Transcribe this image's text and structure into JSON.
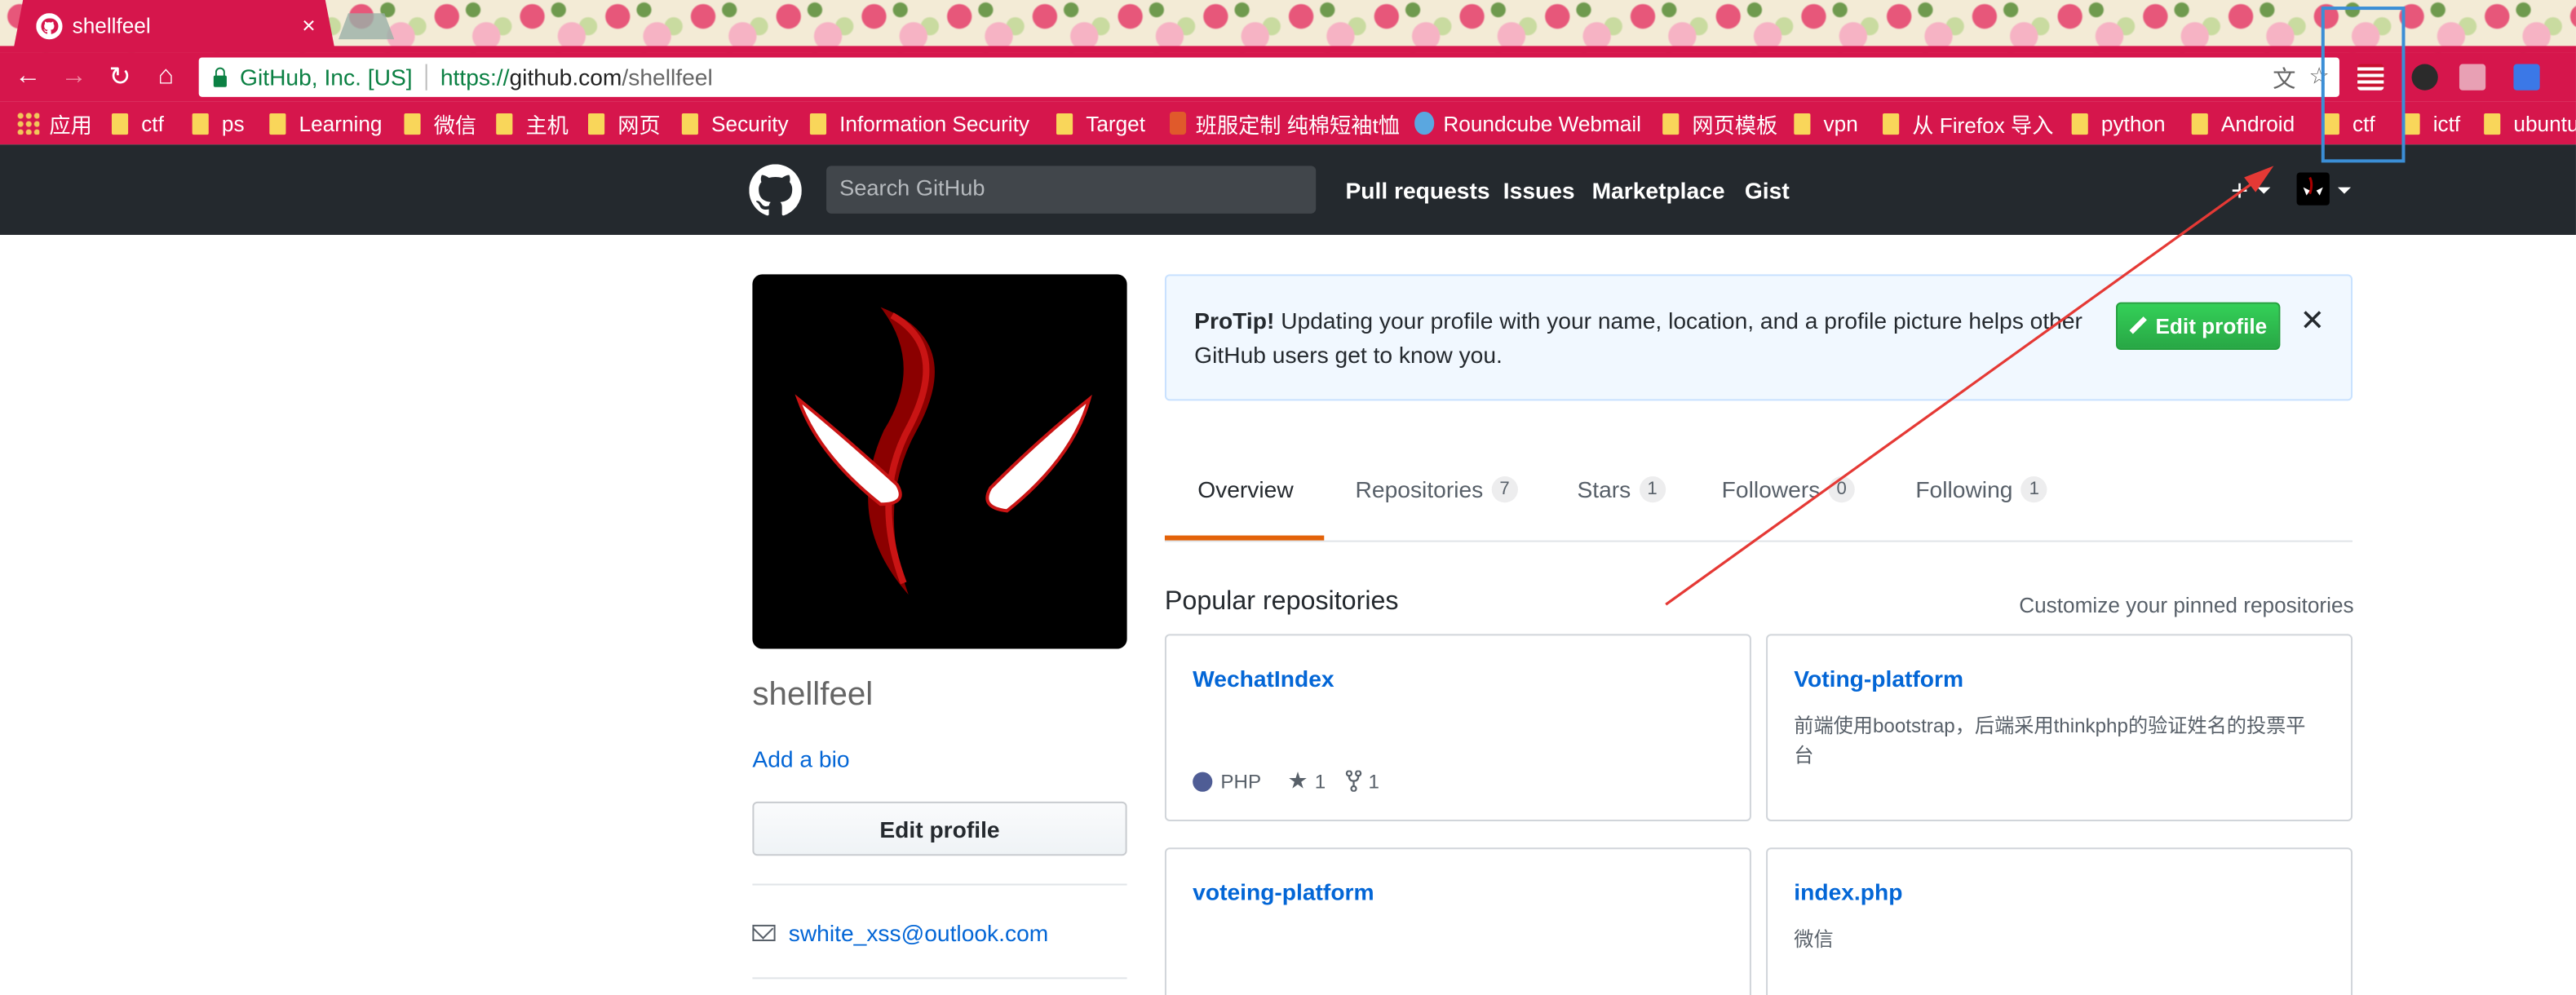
{
  "browser": {
    "tab_title": "shellfeel",
    "tab_close": "×",
    "org_label": "GitHub, Inc. [US]",
    "url_scheme": "https://",
    "url_host": "github.com",
    "url_path": "/shellfeel",
    "bookmarks": [
      "应用",
      "ctf",
      "ps",
      "Learning",
      "微信",
      "主机",
      "网页",
      "Security",
      "Information Security",
      "Target",
      "班服定制 纯棉短袖t恤",
      "Roundcube Webmail",
      "网页模板",
      "vpn",
      "从 Firefox 导入",
      "python",
      "Android",
      "ctf",
      "ictf",
      "ubuntu"
    ]
  },
  "header": {
    "search_placeholder": "Search GitHub",
    "nav": [
      "Pull requests",
      "Issues",
      "Marketplace",
      "Gist"
    ],
    "plus": "+"
  },
  "profile": {
    "username": "shellfeel",
    "add_bio": "Add a bio",
    "edit_profile": "Edit profile",
    "email": "swhite_xss@outlook.com"
  },
  "protip": {
    "label": "ProTip!",
    "text": " Updating your profile with your name, location, and a profile picture helps other GitHub users get to know you.",
    "button": "Edit profile",
    "close": "✕"
  },
  "tabs": [
    {
      "label": "Overview",
      "count": ""
    },
    {
      "label": "Repositories",
      "count": "7"
    },
    {
      "label": "Stars",
      "count": "1"
    },
    {
      "label": "Followers",
      "count": "0"
    },
    {
      "label": "Following",
      "count": "1"
    }
  ],
  "popular": {
    "title": "Popular repositories",
    "customize": "Customize your pinned repositories",
    "repos": [
      {
        "name": "WechatIndex",
        "desc": "",
        "lang": "PHP",
        "stars": "1",
        "forks": "1"
      },
      {
        "name": "Voting-platform",
        "desc": "前端使用bootstrap，后端采用thinkphp的验证姓名的投票平台"
      },
      {
        "name": "voteing-platform",
        "desc": ""
      },
      {
        "name": "index.php",
        "desc": "微信"
      }
    ]
  },
  "colors": {
    "accent": "#d6164c",
    "link": "#0366d6",
    "tab_underline": "#e36209",
    "annotation_box": "#3b8ed6",
    "annotation_arrow": "#e53935"
  }
}
